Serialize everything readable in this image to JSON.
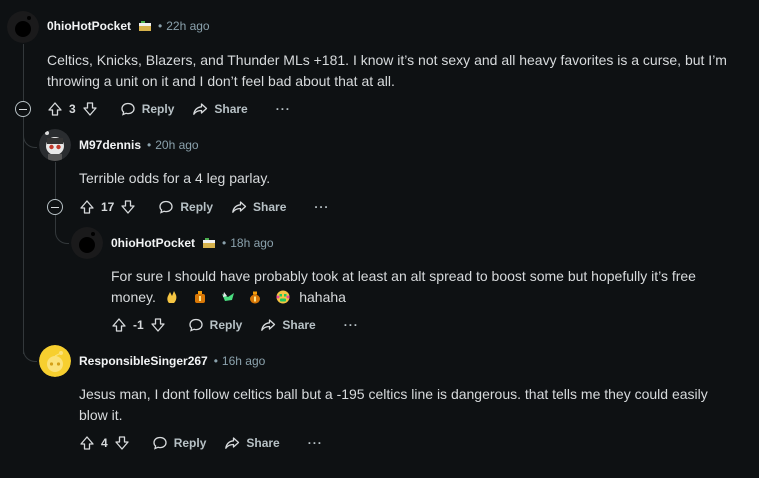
{
  "comments": [
    {
      "username": "0hioHotPocket",
      "time": "22h ago",
      "text_lines": [
        "Celtics, Knicks, Blazers, and Thunder MLs +181. I know it’s not sexy and all heavy favorites is a curse, but I’m",
        "throwing a unit on it and I don’t feel bad about that at all."
      ],
      "score": "3",
      "reply_label": "Reply",
      "share_label": "Share",
      "more_label": "···"
    },
    {
      "username": "M97dennis",
      "time": "20h ago",
      "text_lines": [
        "Terrible odds for a 4 leg parlay."
      ],
      "score": "17",
      "reply_label": "Reply",
      "share_label": "Share",
      "more_label": "···"
    },
    {
      "username": "0hioHotPocket",
      "time": "18h ago",
      "text_lines": [
        "For sure I should have probably took at least an alt spread to boost some but hopefully it’s free",
        "money."
      ],
      "trailing_text": "hahaha",
      "score": "-1",
      "reply_label": "Reply",
      "share_label": "Share",
      "more_label": "···"
    },
    {
      "username": "ResponsibleSinger267",
      "time": "16h ago",
      "text_lines": [
        "Jesus man, I dont follow celtics ball but a -195 celtics line is dangerous. that tells me they could easily",
        "blow it."
      ],
      "score": "4",
      "reply_label": "Reply",
      "share_label": "Share",
      "more_label": "···"
    }
  ],
  "separator": "•",
  "colors": {
    "background": "#0e1113",
    "text": "#d7dadc",
    "muted": "#8ba2ad",
    "thread_line": "#33383b",
    "avatar_yellow": "#f7cf2f"
  }
}
